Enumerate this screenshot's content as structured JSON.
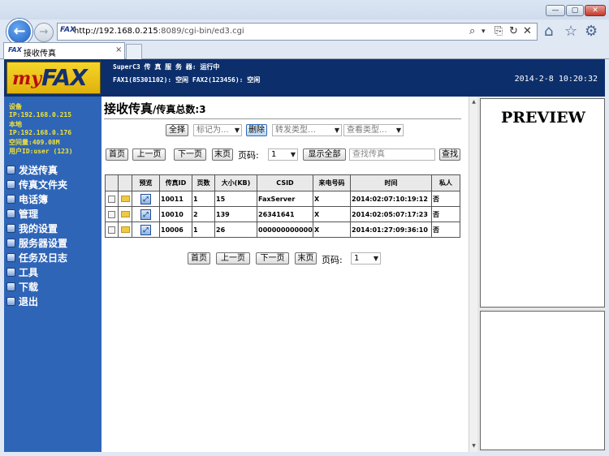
{
  "browser": {
    "url_host": "http://192.168.0.215",
    "url_path": ":8089/cgi-bin/ed3.cgi",
    "favicon_text": "FAX",
    "tab_title": "接收传真",
    "tab_close": "×",
    "controls": {
      "minimize": "—",
      "maximize": "▢",
      "close": "✕",
      "back": "←",
      "forward": "→",
      "search": "⌕",
      "dropdown": "▾",
      "compat": "⎘",
      "refresh": "↻",
      "stop": "✕",
      "home": "⌂",
      "favorites": "☆",
      "settings": "⚙"
    }
  },
  "header": {
    "logo_my": "my",
    "logo_fax": "FAX",
    "status_line1": "SuperC3 传 真 服 务 器: 运行中",
    "status_line2": "FAX1(85301102): 空闲    FAX2(123456): 空闲",
    "datetime": "2014-2-8  10:20:32"
  },
  "sidebar": {
    "info": [
      "设备",
      "IP:192.168.0.215",
      "本地",
      "IP:192.168.0.176",
      "空间量:409.08M",
      "用户ID:user (123)"
    ],
    "nav": [
      {
        "id": "send-fax",
        "label": "发送传真"
      },
      {
        "id": "fax-folder",
        "label": "传真文件夹"
      },
      {
        "id": "phonebook",
        "label": "电话簿"
      },
      {
        "id": "manage",
        "label": "管理"
      },
      {
        "id": "my-settings",
        "label": "我的设置"
      },
      {
        "id": "server-settings",
        "label": "服务器设置"
      },
      {
        "id": "tasks-logs",
        "label": "任务及日志"
      },
      {
        "id": "tools",
        "label": "工具"
      },
      {
        "id": "download",
        "label": "下载"
      },
      {
        "id": "logout",
        "label": "退出"
      }
    ]
  },
  "content": {
    "title": "接收传真",
    "title_sub": "/传真总数:3",
    "toolbar": {
      "select_all": "全择",
      "mark_as": "标记为...",
      "delete": "删除",
      "forward_type": "转发类型…",
      "view_type": "查看类型..."
    },
    "pager": {
      "first": "首页",
      "prev": "上一页",
      "next": "下一页",
      "last": "末页",
      "page_label": "页码:",
      "page_value": "1",
      "show_all": "显示全部",
      "search_placeholder": "查找传真",
      "search": "查找"
    },
    "table": {
      "headers": [
        "",
        "",
        "预览",
        "传真ID",
        "页数",
        "大小(KB)",
        "CSID",
        "来电号码",
        "时间",
        "私人"
      ],
      "rows": [
        {
          "id": "10011",
          "pages": "1",
          "size": "15",
          "csid": "FaxServer",
          "caller": "X",
          "time": "2014:02:07:10:19:12",
          "private": "否"
        },
        {
          "id": "10010",
          "pages": "2",
          "size": "139",
          "csid": "26341641",
          "caller": "X",
          "time": "2014:02:05:07:17:23",
          "private": "否"
        },
        {
          "id": "10006",
          "pages": "1",
          "size": "26",
          "csid": "0000000000000",
          "caller": "X",
          "time": "2014:01:27:09:36:10",
          "private": "否"
        }
      ]
    }
  },
  "preview": {
    "title": "PREVIEW"
  }
}
